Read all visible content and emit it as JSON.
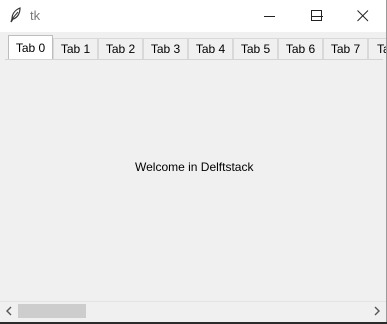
{
  "window": {
    "title": "tk",
    "app_icon": "feather-icon",
    "controls": [
      "minimize-icon",
      "maximize-icon",
      "close-icon"
    ]
  },
  "notebook": {
    "active_index": 0,
    "tabs": [
      {
        "label": "Tab 0"
      },
      {
        "label": "Tab 1"
      },
      {
        "label": "Tab 2"
      },
      {
        "label": "Tab 3"
      },
      {
        "label": "Tab 4"
      },
      {
        "label": "Tab 5"
      },
      {
        "label": "Tab 6"
      },
      {
        "label": "Tab 7"
      },
      {
        "label": "Ta"
      }
    ]
  },
  "content": {
    "label": "Welcome in Delftstack"
  },
  "scrollbar": {
    "left_arrow": "chevron-left-icon",
    "right_arrow": "chevron-right-icon"
  },
  "colors": {
    "window_bg": "#f0f0f0",
    "titlebar_bg": "#ffffff",
    "tab_active_bg": "#ffffff",
    "scroll_thumb": "#cdcdcd"
  }
}
